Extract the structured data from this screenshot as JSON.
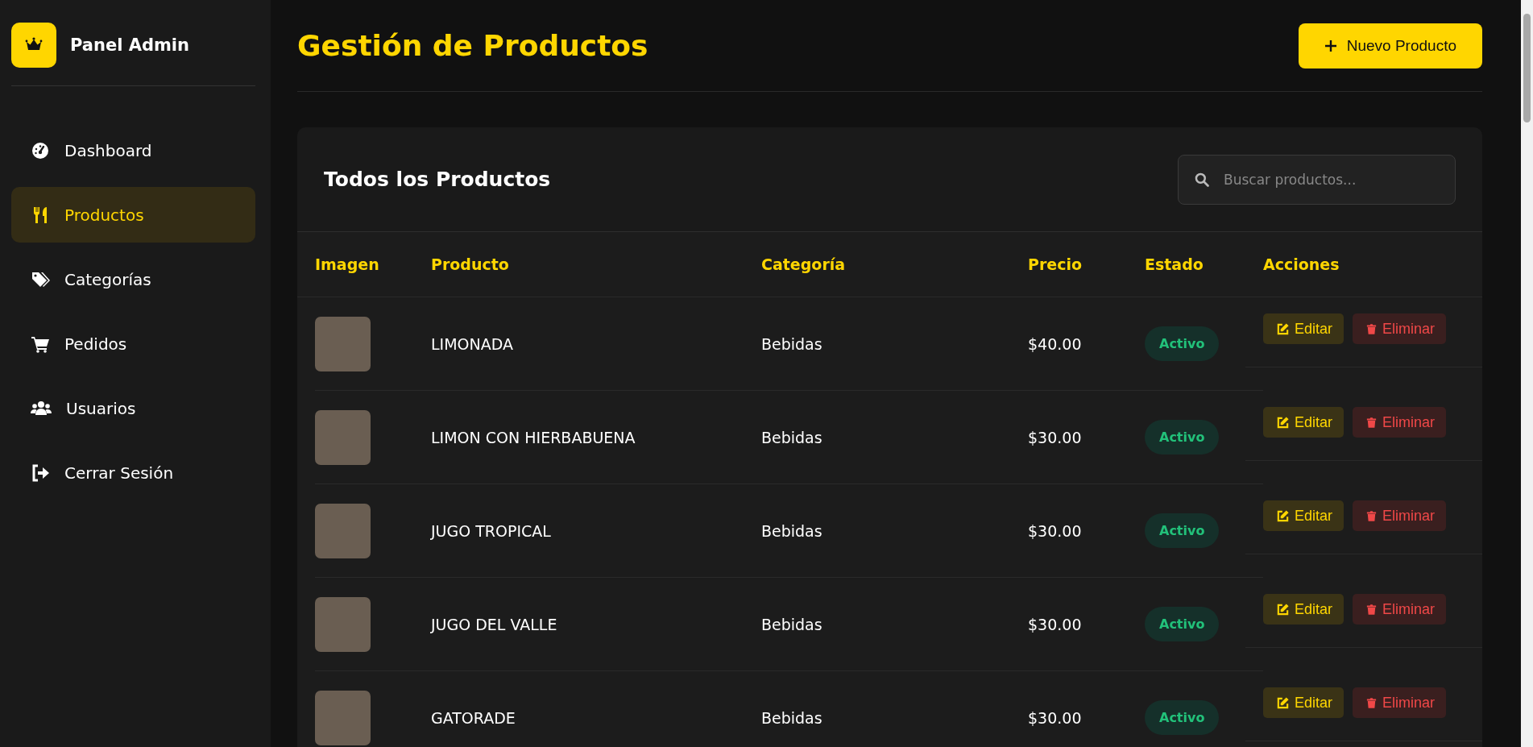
{
  "sidebar": {
    "brand": "Panel Admin",
    "items": [
      {
        "label": "Dashboard",
        "selected": false
      },
      {
        "label": "Productos",
        "selected": true
      },
      {
        "label": "Categorías",
        "selected": false
      },
      {
        "label": "Pedidos",
        "selected": false
      },
      {
        "label": "Usuarios",
        "selected": false
      },
      {
        "label": "Cerrar Sesión",
        "selected": false
      }
    ]
  },
  "header": {
    "title": "Gestión de Productos",
    "new_button": "Nuevo Producto"
  },
  "card": {
    "title": "Todos los Productos",
    "search": {
      "placeholder": "Buscar productos..."
    }
  },
  "table": {
    "columns": [
      "Imagen",
      "Producto",
      "Categoría",
      "Precio",
      "Estado",
      "Acciones"
    ],
    "rows": [
      {
        "product": "LIMONADA",
        "category": "Bebidas",
        "price": "$40.00",
        "status": {
          "label": "Activo",
          "kind": "active"
        },
        "actions": [
          {
            "label": "Editar",
            "kind": "edit"
          },
          {
            "label": "Eliminar",
            "kind": "delete"
          }
        ]
      },
      {
        "product": "LIMON CON HIERBABUENA",
        "category": "Bebidas",
        "price": "$30.00",
        "status": {
          "label": "Activo",
          "kind": "active"
        },
        "actions": [
          {
            "label": "Editar",
            "kind": "edit"
          },
          {
            "label": "Eliminar",
            "kind": "delete"
          }
        ]
      },
      {
        "product": "JUGO TROPICAL",
        "category": "Bebidas",
        "price": "$30.00",
        "status": {
          "label": "Activo",
          "kind": "active"
        },
        "actions": [
          {
            "label": "Editar",
            "kind": "edit"
          },
          {
            "label": "Eliminar",
            "kind": "delete"
          }
        ]
      },
      {
        "product": "JUGO DEL VALLE",
        "category": "Bebidas",
        "price": "$30.00",
        "status": {
          "label": "Activo",
          "kind": "active"
        },
        "actions": [
          {
            "label": "Editar",
            "kind": "edit"
          },
          {
            "label": "Eliminar",
            "kind": "delete"
          }
        ]
      },
      {
        "product": "GATORADE",
        "category": "Bebidas",
        "price": "$30.00",
        "status": {
          "label": "Activo",
          "kind": "active"
        },
        "actions": [
          {
            "label": "Editar",
            "kind": "edit"
          },
          {
            "label": "Eliminar",
            "kind": "delete"
          }
        ]
      }
    ]
  }
}
